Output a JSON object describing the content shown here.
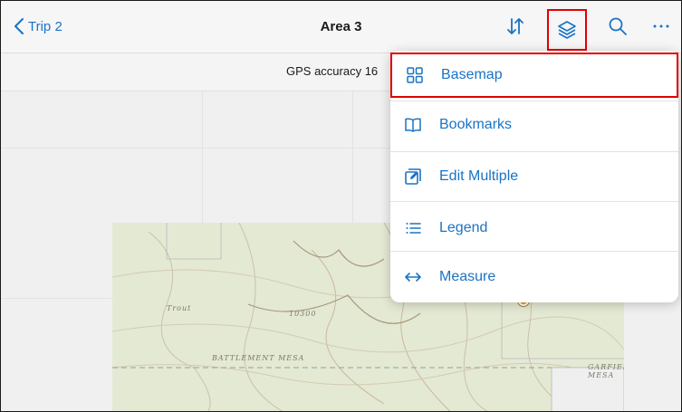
{
  "navbar": {
    "back_label": "Trip 2",
    "title": "Area 3"
  },
  "gps": {
    "text": "GPS accuracy 16"
  },
  "map": {
    "labels": [
      "BATTLEMENT MESA",
      "GARFIEL MESA",
      "Trout",
      "10300"
    ]
  },
  "menu": {
    "items": [
      {
        "label": "Basemap",
        "icon": "basemap-grid-icon"
      },
      {
        "label": "Bookmarks",
        "icon": "book-icon"
      },
      {
        "label": "Edit Multiple",
        "icon": "edit-multiple-icon"
      },
      {
        "label": "Legend",
        "icon": "list-icon"
      },
      {
        "label": "Measure",
        "icon": "measure-arrows-icon"
      }
    ]
  },
  "colors": {
    "accent": "#1a73c4",
    "highlight": "#e00000"
  }
}
